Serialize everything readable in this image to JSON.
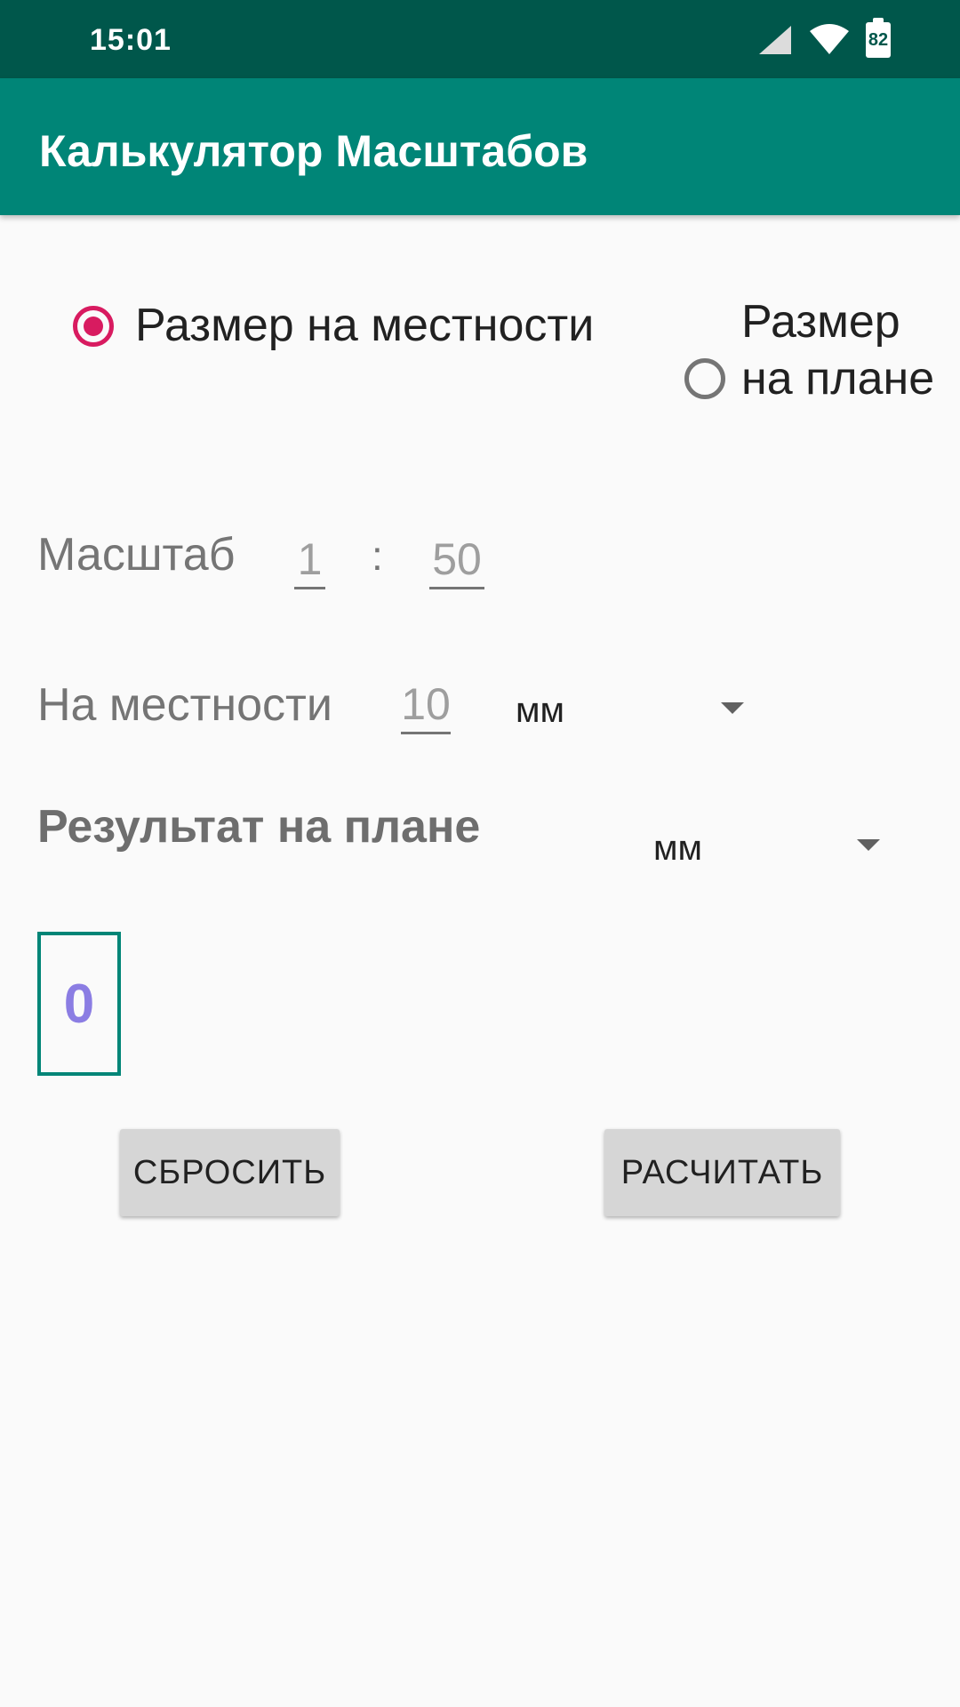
{
  "status_bar": {
    "time": "15:01",
    "battery": "82",
    "icons": [
      "cell-signal-icon",
      "wifi-icon",
      "battery-icon"
    ]
  },
  "app_bar": {
    "title": "Калькулятор Масштабов"
  },
  "mode": {
    "option_terrain": "Размер на местности",
    "option_plan": "Размер на плане",
    "selected": "option_terrain"
  },
  "scale": {
    "label": "Масштаб",
    "left_value": "1",
    "separator": ":",
    "right_value": "50"
  },
  "terrain": {
    "label": "На местности",
    "value": "10",
    "unit": "мм"
  },
  "result": {
    "label": "Результат на плане",
    "unit": "мм",
    "value": "0"
  },
  "buttons": {
    "reset": "СБРОСИТЬ",
    "calculate": "РАСЧИТАТЬ"
  },
  "colors": {
    "status_bar": "#00574b",
    "app_bar": "#008577",
    "accent": "#d81b60",
    "result_text": "#8b7de3"
  }
}
